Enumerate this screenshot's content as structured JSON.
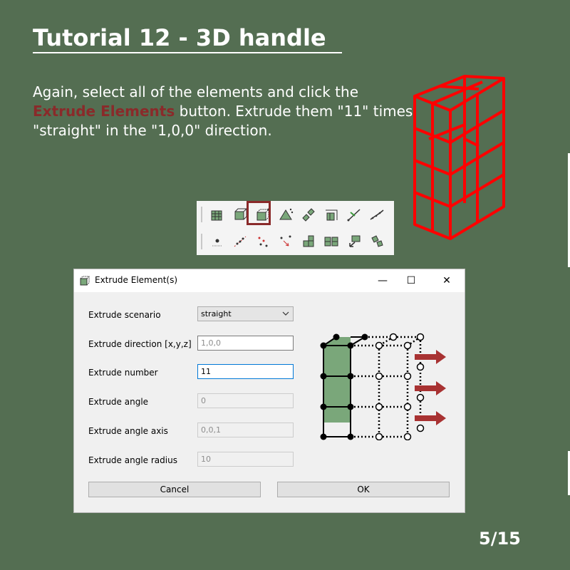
{
  "slide": {
    "title": "Tutorial 12 - 3D handle",
    "instruction_pre": "Again, select all of the elements and click the ",
    "instruction_highlight": "Extrude Elements",
    "instruction_post": " button. Extrude them \"11\" times, \"straight\" in the \"1,0,0\" direction.",
    "page_number": "5/15",
    "highlight_color": "#8a2a2a",
    "wireframe_color": "#ff0000"
  },
  "toolbar": {
    "row1_icons": [
      "create-elements-icon",
      "extrude-nodes-icon",
      "extrude-elements-icon",
      "revolve-icon",
      "copy-elements-icon",
      "split-elements-icon",
      "line-icon",
      "spline-icon"
    ],
    "row2_icons": [
      "node-icon",
      "move-nodes-icon",
      "project-nodes-icon",
      "merge-nodes-icon",
      "join-elements-icon",
      "split-element-icon",
      "mirror-icon",
      "rotate-icon"
    ]
  },
  "dialog": {
    "title": "Extrude Element(s)",
    "minimize_glyph": "—",
    "maximize_glyph": "☐",
    "close_glyph": "✕",
    "fields": {
      "scenario_label": "Extrude scenario",
      "scenario_value": "straight",
      "direction_label": "Extrude direction [x,y,z]",
      "direction_value": "1,0,0",
      "number_label": "Extrude number",
      "number_value": "11",
      "angle_label": "Extrude angle",
      "angle_value": "0",
      "axis_label": "Extrude angle axis",
      "axis_value": "0,0,1",
      "radius_label": "Extrude angle radius",
      "radius_value": "10"
    },
    "cancel_label": "Cancel",
    "ok_label": "OK",
    "element_fill": "#7aa77a",
    "arrow_color": "#a83232"
  }
}
